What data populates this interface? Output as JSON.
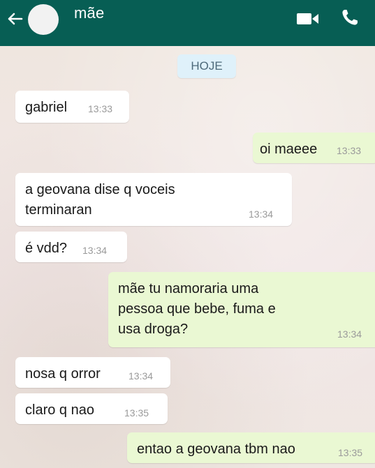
{
  "header": {
    "contact_name": "mãe",
    "icons": [
      "back-arrow-icon",
      "avatar",
      "video-camera-icon",
      "phone-icon"
    ],
    "bar_color": "#075e54"
  },
  "date_chip": "HOJE",
  "messages": [
    {
      "direction": "incoming",
      "lines": [
        "gabriel"
      ],
      "time": "13:33"
    },
    {
      "direction": "outgoing",
      "lines": [
        "oi maeee"
      ],
      "time": "13:33"
    },
    {
      "direction": "incoming",
      "lines": [
        "a geovana dise q voceis",
        "terminaran"
      ],
      "time": "13:34"
    },
    {
      "direction": "incoming",
      "lines": [
        "é vdd?"
      ],
      "time": "13:34"
    },
    {
      "direction": "outgoing",
      "lines": [
        "mãe tu namoraria uma",
        "pessoa que bebe, fuma e",
        "usa droga?"
      ],
      "time": "13:34"
    },
    {
      "direction": "incoming",
      "lines": [
        "nosa q orror"
      ],
      "time": "13:34"
    },
    {
      "direction": "incoming",
      "lines": [
        "claro q nao"
      ],
      "time": "13:35"
    },
    {
      "direction": "outgoing",
      "lines": [
        "entao a geovana tbm nao"
      ],
      "time": "13:35"
    }
  ],
  "colors": {
    "incoming_bubble": "#ffffff",
    "outgoing_bubble": "#eaf8d3",
    "date_chip_bg": "#dff1fa"
  }
}
